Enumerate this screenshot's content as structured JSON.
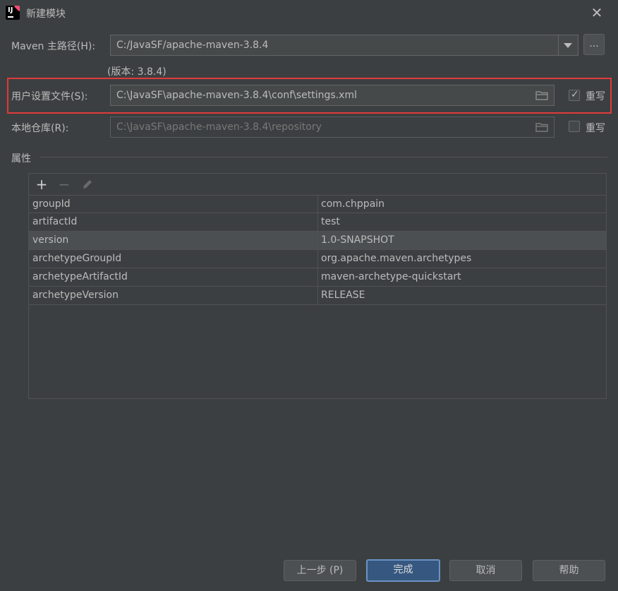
{
  "window": {
    "title": "新建模块",
    "close_icon": "close-icon"
  },
  "maven_home": {
    "label": "Maven 主路径(H):",
    "value": "C:/JavaSF/apache-maven-3.8.4",
    "browse_label": "...",
    "version": "(版本: 3.8.4)"
  },
  "user_settings": {
    "label": "用户设置文件(S):",
    "value": "C:\\JavaSF\\apache-maven-3.8.4\\conf\\settings.xml",
    "override_label": "重写",
    "override_checked": true
  },
  "local_repo": {
    "label": "本地仓库(R):",
    "value": "C:\\JavaSF\\apache-maven-3.8.4\\repository",
    "override_label": "重写",
    "override_checked": false
  },
  "properties": {
    "title": "属性",
    "toolbar": {
      "add": "+",
      "remove": "−"
    },
    "rows": [
      {
        "key": "groupId",
        "value": "com.chppain"
      },
      {
        "key": "artifactId",
        "value": "test"
      },
      {
        "key": "version",
        "value": "1.0-SNAPSHOT"
      },
      {
        "key": "archetypeGroupId",
        "value": "org.apache.maven.archetypes"
      },
      {
        "key": "archetypeArtifactId",
        "value": "maven-archetype-quickstart"
      },
      {
        "key": "archetypeVersion",
        "value": "RELEASE"
      }
    ]
  },
  "buttons": {
    "previous": "上一步 (P)",
    "finish": "完成",
    "cancel": "取消",
    "help": "帮助"
  },
  "colors": {
    "background": "#3c3f41",
    "highlight": "#e03a3a",
    "primary_button": "#365880"
  }
}
